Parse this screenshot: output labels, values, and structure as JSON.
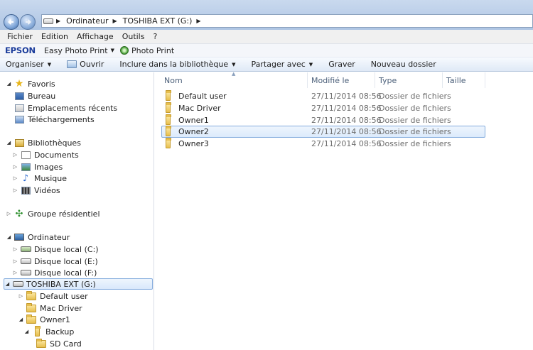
{
  "address": {
    "segments": [
      "Ordinateur",
      "TOSHIBA EXT (G:)"
    ]
  },
  "menu": {
    "items": [
      "Fichier",
      "Edition",
      "Affichage",
      "Outils",
      "?"
    ]
  },
  "epson": {
    "logo": "EPSON",
    "easy_photo_print": "Easy Photo Print",
    "photo_print": "Photo Print"
  },
  "commands": {
    "organiser": "Organiser",
    "ouvrir": "Ouvrir",
    "inclure": "Inclure dans la bibliothèque",
    "partager": "Partager avec",
    "graver": "Graver",
    "nouveau_dossier": "Nouveau dossier"
  },
  "nav": {
    "favoris": "Favoris",
    "bureau": "Bureau",
    "recents": "Emplacements récents",
    "telechargements": "Téléchargements",
    "bibliotheques": "Bibliothèques",
    "documents": "Documents",
    "images": "Images",
    "musique": "Musique",
    "videos": "Vidéos",
    "groupe": "Groupe résidentiel",
    "ordinateur": "Ordinateur",
    "disque_c": "Disque local (C:)",
    "disque_e": "Disque local (E:)",
    "disque_f": "Disque local (F:)",
    "toshiba": "TOSHIBA EXT (G:)",
    "default_user": "Default user",
    "mac_driver": "Mac Driver",
    "owner1": "Owner1",
    "backup": "Backup",
    "sd_card": "SD Card"
  },
  "columns": {
    "name": "Nom",
    "modified": "Modifié le",
    "type": "Type",
    "size": "Taille"
  },
  "files": [
    {
      "name": "Default user",
      "modified": "27/11/2014 08:56",
      "type": "Dossier de fichiers"
    },
    {
      "name": "Mac Driver",
      "modified": "27/11/2014 08:56",
      "type": "Dossier de fichiers"
    },
    {
      "name": "Owner1",
      "modified": "27/11/2014 08:56",
      "type": "Dossier de fichiers"
    },
    {
      "name": "Owner2",
      "modified": "27/11/2014 08:56",
      "type": "Dossier de fichiers"
    },
    {
      "name": "Owner3",
      "modified": "27/11/2014 08:56",
      "type": "Dossier de fichiers"
    }
  ],
  "icons": {
    "folder": "folder-icon",
    "drive": "drive-icon",
    "favorites": "star-icon"
  },
  "colors": {
    "selection_border": "#84acdd",
    "epson_blue": "#1b3c9b"
  }
}
